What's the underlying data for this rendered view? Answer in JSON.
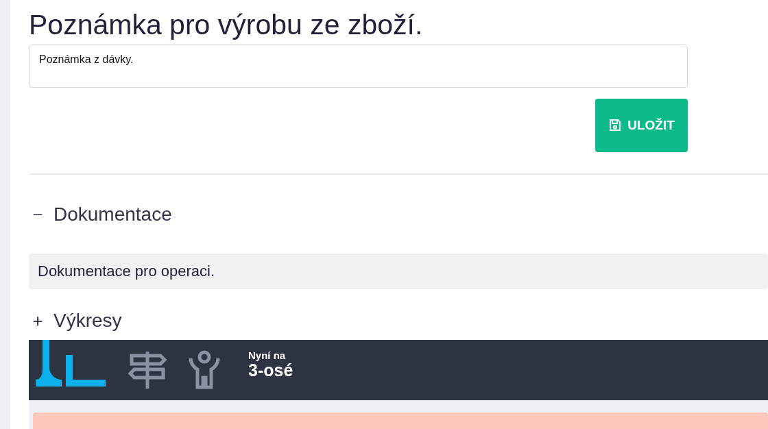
{
  "note_heading": "Poznámka pro výrobu ze zboží.",
  "note_field": {
    "value": "Poznámka z dávky."
  },
  "save_button": {
    "label": "ULOŽIT"
  },
  "sections": [
    {
      "toggle": "−",
      "title": "Dokumentace",
      "expanded": true,
      "content": "Dokumentace pro operaci."
    },
    {
      "toggle": "+",
      "title": "Výkresy",
      "expanded": false
    }
  ],
  "embedded_app": {
    "status_label": "Nyní na",
    "status_value": "3-osé"
  }
}
